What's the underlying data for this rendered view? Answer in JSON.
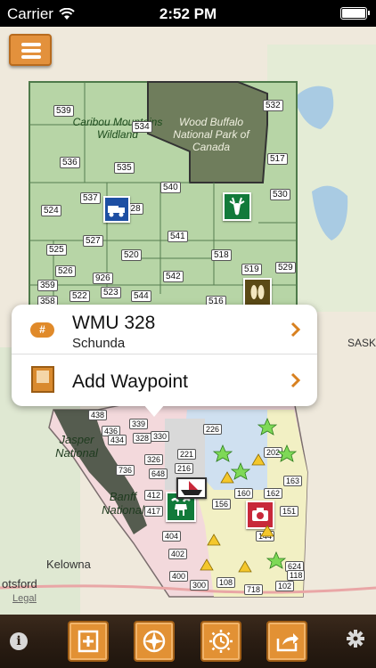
{
  "status_bar": {
    "carrier": "Carrier",
    "time": "2:52 PM"
  },
  "map": {
    "place_labels": [
      "SASK",
      "Kelowna",
      "otsford",
      "Legal"
    ],
    "parks": [
      "Caribou Mountains Wildland",
      "Wood Buffalo National Park of Canada",
      "Jasper National",
      "Banff National"
    ],
    "units_north": [
      "539",
      "534",
      "532",
      "536",
      "535",
      "517",
      "540",
      "530",
      "537",
      "528",
      "524",
      "541",
      "525",
      "527",
      "520",
      "518",
      "519",
      "529",
      "526",
      "926",
      "359",
      "542",
      "523",
      "522",
      "544",
      "516",
      "358"
    ],
    "units_south": [
      "438",
      "436",
      "434",
      "339",
      "328",
      "330",
      "736",
      "326",
      "648",
      "412",
      "417",
      "216",
      "156",
      "160",
      "162",
      "404",
      "402",
      "400",
      "300",
      "108",
      "718",
      "102",
      "151",
      "144",
      "226",
      "221",
      "202",
      "163",
      "624",
      "118"
    ]
  },
  "popover": {
    "unit_title": "WMU 328",
    "unit_subtitle": "Schunda",
    "waypoint_label": "Add Waypoint",
    "hash_symbol": "#"
  },
  "toolbar": {
    "info_symbol": "i"
  },
  "colors": {
    "accent": "#e29134",
    "toolbar": "#2a1d13",
    "map_green": "#b9d6a7",
    "park_dark": "#6d7d5a"
  }
}
